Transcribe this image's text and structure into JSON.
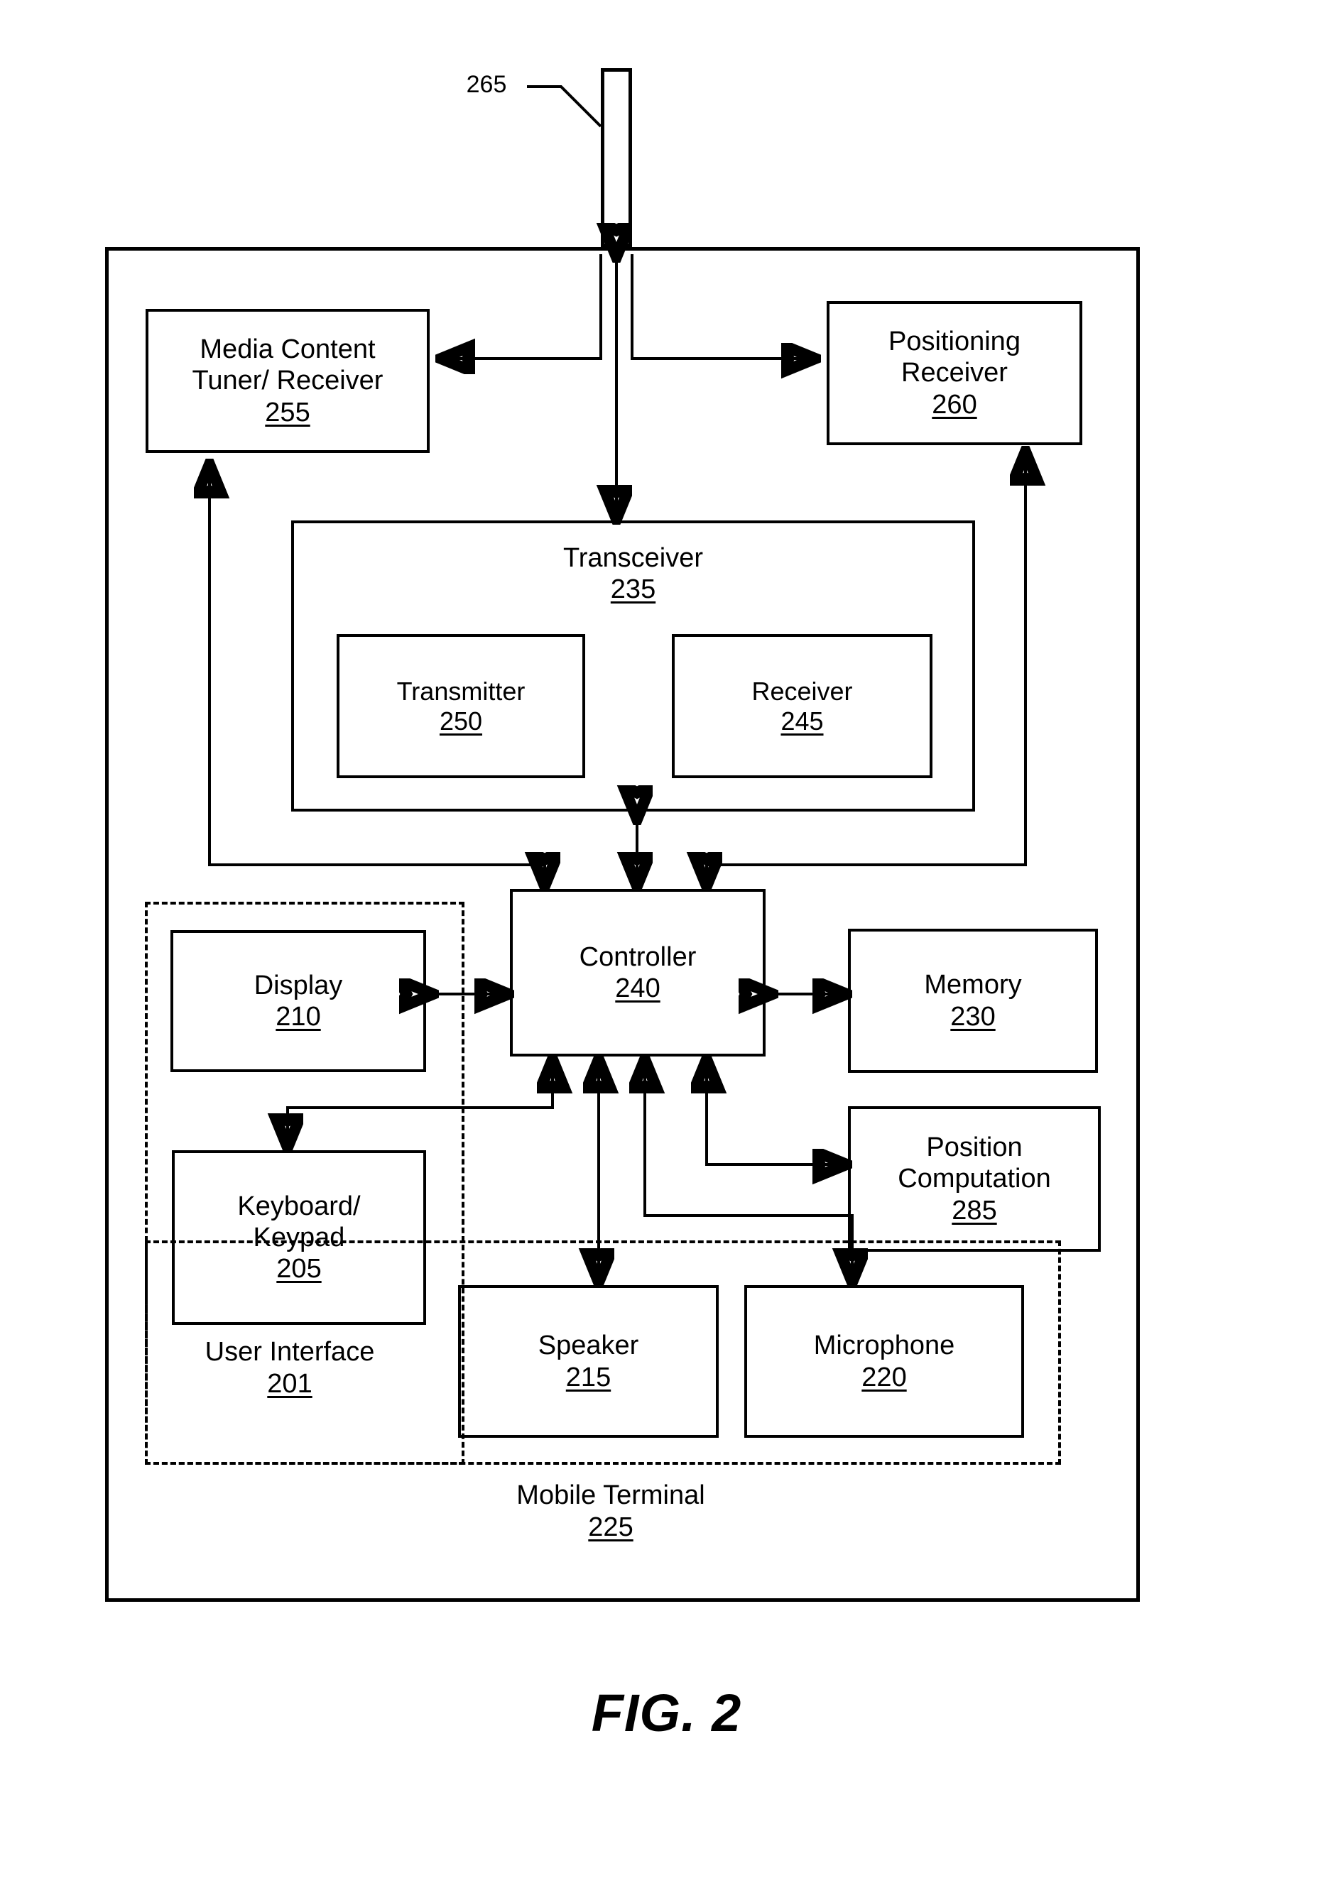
{
  "figure": {
    "caption": "FIG. 2",
    "antenna_ref": "265"
  },
  "outer_system": {
    "name": "Mobile Terminal",
    "number": "225"
  },
  "user_interface_group": {
    "name": "User Interface",
    "number": "201"
  },
  "blocks": {
    "media_content_tuner": {
      "label": "Media Content\nTuner/ Receiver",
      "number": "255"
    },
    "positioning_receiver": {
      "label": "Positioning\nReceiver",
      "number": "260"
    },
    "transceiver": {
      "label": "Transceiver",
      "number": "235"
    },
    "transmitter": {
      "label": "Transmitter",
      "number": "250"
    },
    "receiver": {
      "label": "Receiver",
      "number": "245"
    },
    "controller": {
      "label": "Controller",
      "number": "240"
    },
    "memory": {
      "label": "Memory",
      "number": "230"
    },
    "display": {
      "label": "Display",
      "number": "210"
    },
    "keyboard_keypad": {
      "label": "Keyboard/\nKeypad",
      "number": "205"
    },
    "position_computation": {
      "label": "Position\nComputation",
      "number": "285"
    },
    "speaker": {
      "label": "Speaker",
      "number": "215"
    },
    "microphone": {
      "label": "Microphone",
      "number": "220"
    }
  },
  "colors": {
    "ink": "#000000",
    "paper": "#ffffff"
  }
}
